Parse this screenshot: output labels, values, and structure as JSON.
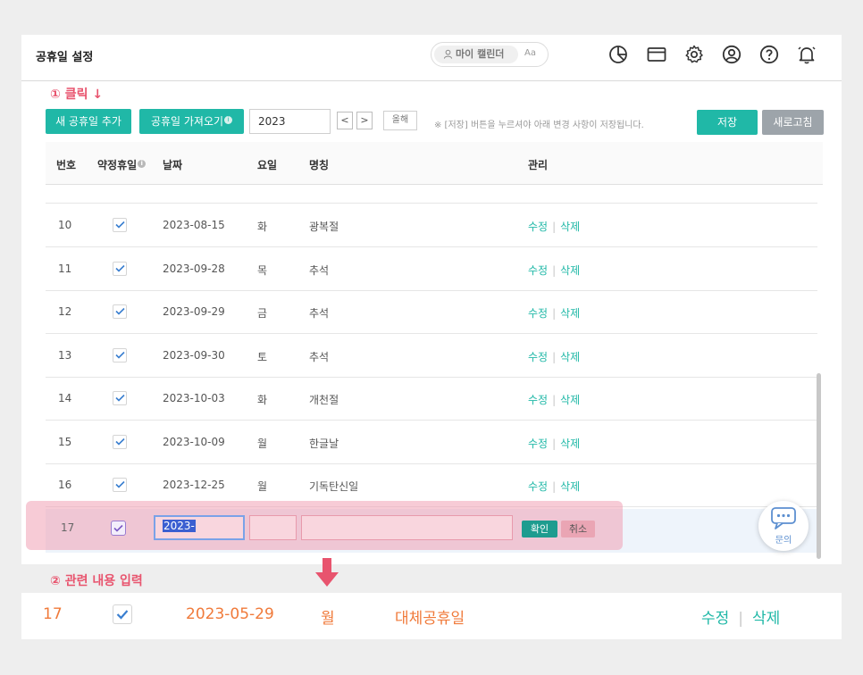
{
  "header": {
    "title": "공휴일 설정",
    "calendar_pill_label": "마이 캘린더",
    "calendar_pill_secondary": "Aa"
  },
  "annotations": {
    "step1": "① 클릭 ↓",
    "step2": "② 관련 내용 입력"
  },
  "toolbar": {
    "add_label": "새 공휴일 추가",
    "import_label": "공휴일 가져오기",
    "import_info": "i",
    "year_value": "2023",
    "prev_label": "<",
    "next_label": ">",
    "this_year_label": "올해",
    "notice": "※ [저장] 버튼을 누르셔야 아래 변경 사항이 저장됩니다.",
    "save_label": "저장",
    "refresh_label": "새로고침"
  },
  "table": {
    "columns": {
      "no": "번호",
      "agreed": "약정휴일",
      "agreed_info": "i",
      "date": "날짜",
      "weekday": "요일",
      "name": "명칭",
      "manage": "관리"
    },
    "rows": [
      {
        "no": "10",
        "date": "2023-08-15",
        "weekday": "화",
        "name": "광복절",
        "checked": true
      },
      {
        "no": "11",
        "date": "2023-09-28",
        "weekday": "목",
        "name": "추석",
        "checked": true
      },
      {
        "no": "12",
        "date": "2023-09-29",
        "weekday": "금",
        "name": "추석",
        "checked": true
      },
      {
        "no": "13",
        "date": "2023-09-30",
        "weekday": "토",
        "name": "추석",
        "checked": true
      },
      {
        "no": "14",
        "date": "2023-10-03",
        "weekday": "화",
        "name": "개천절",
        "checked": true
      },
      {
        "no": "15",
        "date": "2023-10-09",
        "weekday": "월",
        "name": "한글날",
        "checked": true
      },
      {
        "no": "16",
        "date": "2023-12-25",
        "weekday": "월",
        "name": "기독탄신일",
        "checked": true
      }
    ],
    "edit_label": "수정",
    "delete_label": "삭제",
    "new_row": {
      "no": "17",
      "date_value": "2023-",
      "ok_label": "확인",
      "cancel_label": "취소"
    }
  },
  "chat": {
    "label": "문의"
  },
  "result_row": {
    "no": "17",
    "date": "2023-05-29",
    "weekday": "월",
    "name": "대체공휴일",
    "edit_label": "수정",
    "delete_label": "삭제"
  },
  "colors": {
    "accent": "#20b8a7",
    "annotation": "#e8546e",
    "result_text": "#f07a3a",
    "refresh": "#9da4aa"
  }
}
